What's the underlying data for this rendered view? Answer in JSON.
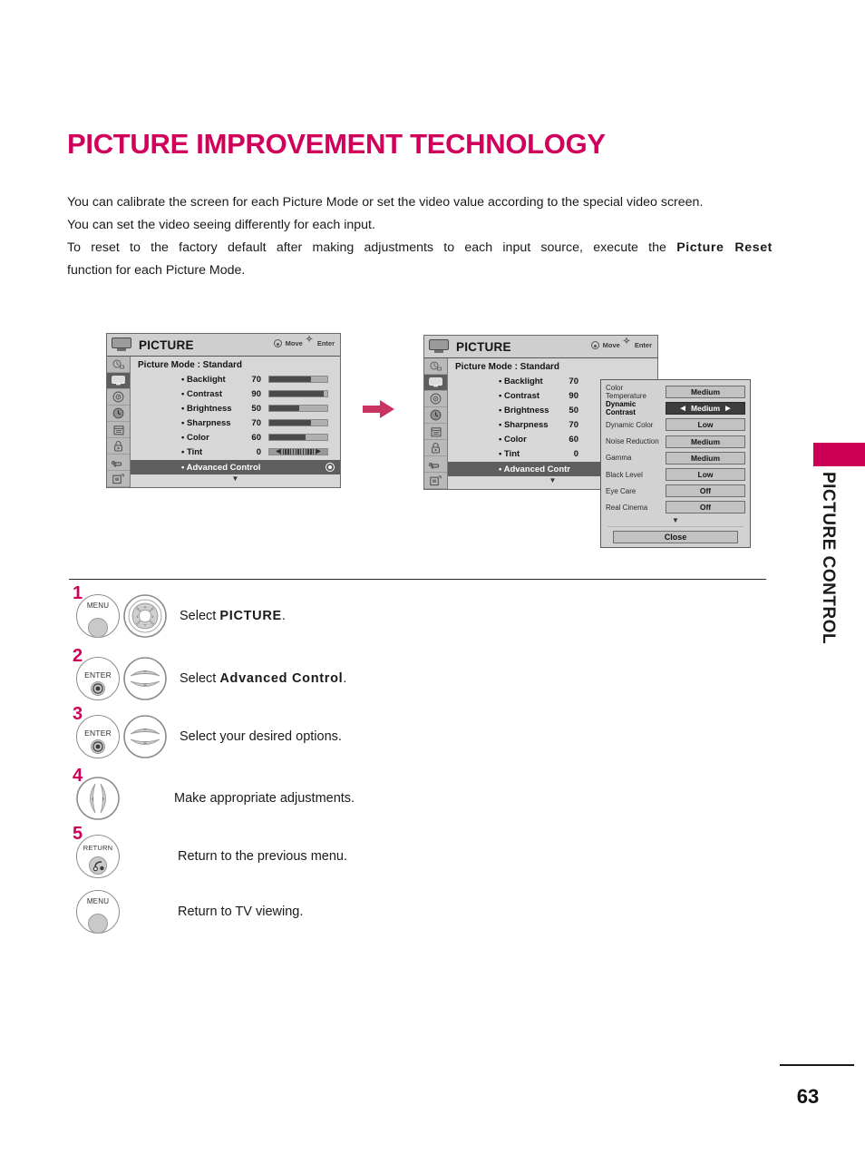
{
  "page": {
    "title": "PICTURE IMPROVEMENT TECHNOLOGY",
    "number": "63",
    "side_tab_label": "PICTURE CONTROL"
  },
  "intro": {
    "line1": "You can calibrate the screen for each Picture Mode or set the video value according to the special video screen.",
    "line2": "You can set the video seeing differently for each input.",
    "line3a": "To reset to the factory default after making adjustments to each input source, execute the",
    "line3b": "Picture Reset",
    "line4": "function for each Picture Mode."
  },
  "osd": {
    "title": "PICTURE",
    "hint_move": "Move",
    "hint_enter": "Enter",
    "picture_mode_label": "Picture Mode",
    "picture_mode_value": ": Standard",
    "items": [
      {
        "label": "• Backlight",
        "value": "70",
        "fill": 72
      },
      {
        "label": "• Contrast",
        "value": "90",
        "fill": 93
      },
      {
        "label": "• Brightness",
        "value": "50",
        "fill": 52
      },
      {
        "label": "• Sharpness",
        "value": "70",
        "fill": 72
      },
      {
        "label": "• Color",
        "value": "60",
        "fill": 62
      },
      {
        "label": "• Tint",
        "value": "0",
        "fill": 0
      }
    ],
    "advanced_label": "• Advanced Control",
    "advanced_label_clipped": "• Advanced Contr",
    "scroll_caret": "▼",
    "rail_icons": [
      "setup-icon",
      "picture-icon",
      "audio-icon",
      "time-icon",
      "option-icon",
      "lock-icon",
      "input-icon",
      "usb-icon"
    ]
  },
  "advanced_panel": {
    "rows": [
      {
        "name": "Color Temperature",
        "value": "Medium",
        "highlighted": false
      },
      {
        "name": "Dynamic Contrast",
        "value": "Medium",
        "highlighted": true
      },
      {
        "name": "Dynamic Color",
        "value": "Low",
        "highlighted": false
      },
      {
        "name": "Noise Reduction",
        "value": "Medium",
        "highlighted": false
      },
      {
        "name": "Gamma",
        "value": "Medium",
        "highlighted": false
      },
      {
        "name": "Black Level",
        "value": "Low",
        "highlighted": false
      },
      {
        "name": "Eye Care",
        "value": "Off",
        "highlighted": false
      },
      {
        "name": "Real Cinema",
        "value": "Off",
        "highlighted": false
      }
    ],
    "arrow_left": "◀",
    "arrow_right": "▶",
    "scroll_caret": "▼",
    "close_label": "Close"
  },
  "steps": [
    {
      "num": "1",
      "button": "MENU",
      "pad": "dpad-4way",
      "text_pre": "Select ",
      "text_bold": "PICTURE",
      "text_post": "."
    },
    {
      "num": "2",
      "button": "ENTER",
      "pad": "updown-rocker",
      "text_pre": "Select ",
      "text_bold": "Advanced Control",
      "text_post": "."
    },
    {
      "num": "3",
      "button": "ENTER",
      "pad": "updown-rocker",
      "text_pre": "Select your desired options.",
      "text_bold": "",
      "text_post": ""
    },
    {
      "num": "4",
      "button": "",
      "pad": "leftright-rocker",
      "text_pre": "Make appropriate adjustments.",
      "text_bold": "",
      "text_post": ""
    },
    {
      "num": "5",
      "button": "RETURN",
      "pad": "",
      "text_pre": "Return to the previous menu.",
      "text_bold": "",
      "text_post": ""
    },
    {
      "num": "",
      "button": "MENU",
      "pad": "",
      "text_pre": "Return to TV viewing.",
      "text_bold": "",
      "text_post": ""
    }
  ],
  "colors": {
    "accent": "#d1005a",
    "tab": "#cc0055",
    "arrow": "#c9335f",
    "osd_background": "#d7d7d7",
    "osd_highlight": "#5e5e5e"
  }
}
